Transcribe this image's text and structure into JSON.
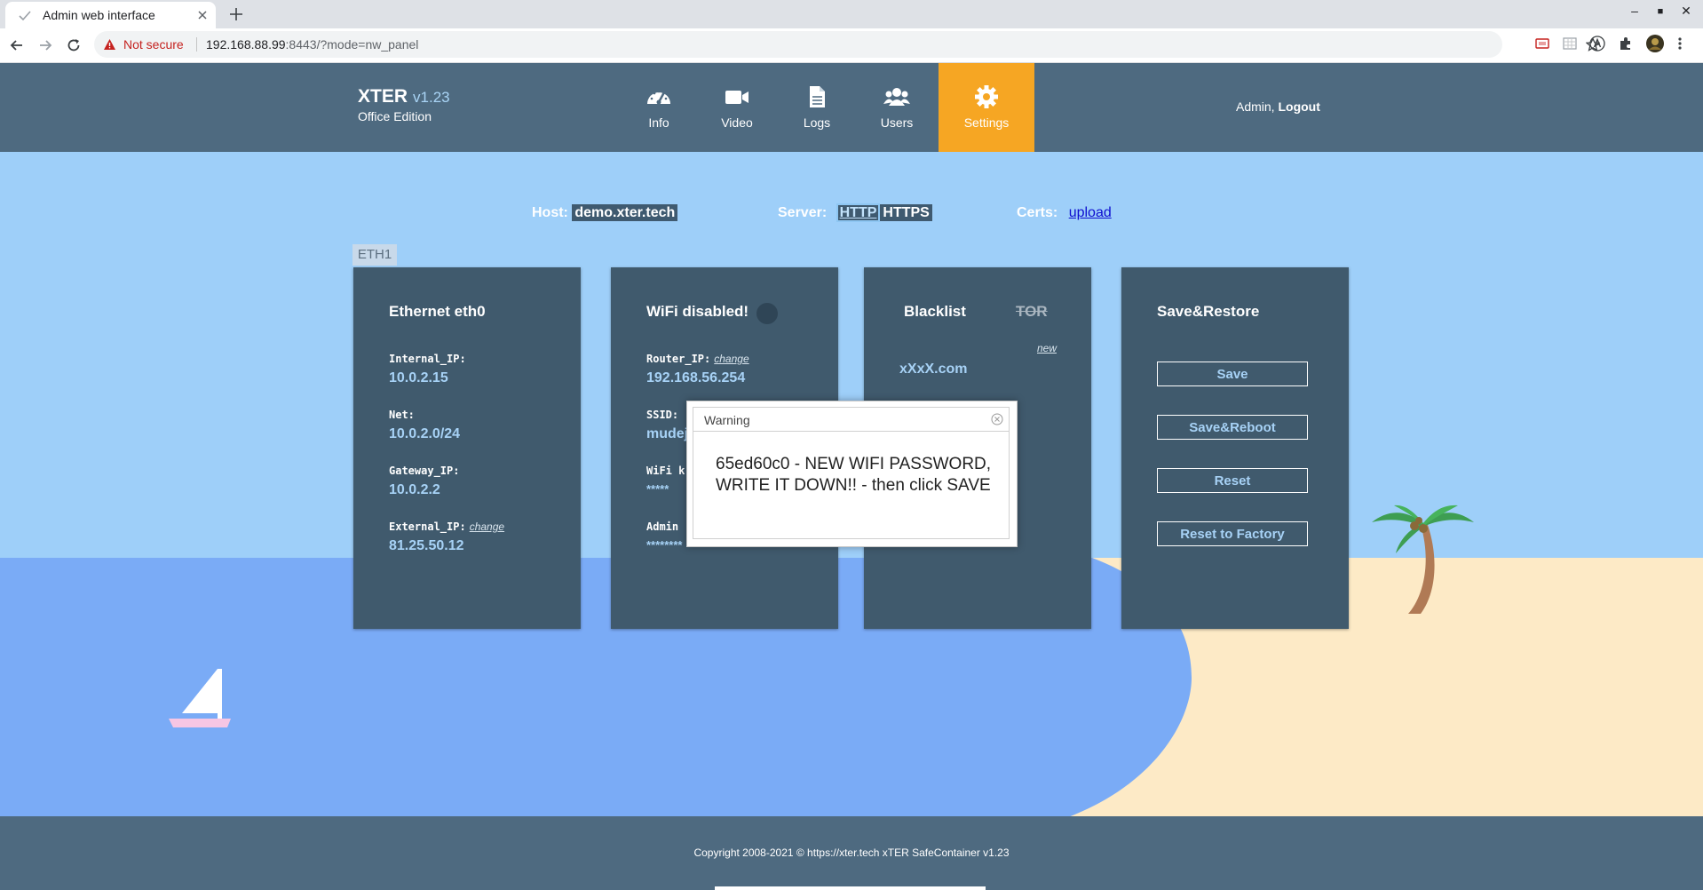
{
  "browser": {
    "tab_title": "Admin web interface",
    "security_label": "Not secure",
    "url_host": "192.168.88.99",
    "url_rest": ":8443/?mode=nw_panel"
  },
  "header": {
    "brand_name": "XTER",
    "brand_version": "v1.23",
    "brand_edition": "Office Edition",
    "nav": [
      {
        "label": "Info",
        "icon": "speedometer-icon"
      },
      {
        "label": "Video",
        "icon": "video-camera-icon"
      },
      {
        "label": "Logs",
        "icon": "document-icon"
      },
      {
        "label": "Users",
        "icon": "users-icon"
      },
      {
        "label": "Settings",
        "icon": "gear-icon",
        "active": true
      }
    ],
    "user_name": "Admin,",
    "logout_label": "Logout"
  },
  "hostbar": {
    "host_label": "Host:",
    "host_value": "demo.xter.tech",
    "server_label": "Server:",
    "server_http": "HTTP",
    "server_https": "HTTPS",
    "certs_label": "Certs:",
    "certs_link": "upload",
    "eth_tab": "ETH1"
  },
  "ethernet": {
    "title": "Ethernet eth0",
    "internal_ip_label": "Internal_IP:",
    "internal_ip": "10.0.2.15",
    "net_label": "Net:",
    "net": "10.0.2.0/24",
    "gateway_label": "Gateway_IP:",
    "gateway": "10.0.2.2",
    "external_label": "External_IP:",
    "external_change": "change",
    "external_ip": "81.25.50.12"
  },
  "wifi": {
    "title": "WiFi disabled!",
    "router_label": "Router_IP:",
    "router_change": "change",
    "router_ip": "192.168.56.254",
    "ssid_label": "SSID:",
    "ssid_value": "mudej",
    "key_label": "WiFi k",
    "key_value": "*****",
    "admin_label": "Admin",
    "admin_value": "********"
  },
  "blacklist": {
    "title": "Blacklist",
    "tor_label": "TOR",
    "new_link": "new",
    "items": [
      "xXxX.com"
    ]
  },
  "save_restore": {
    "title": "Save&Restore",
    "save": "Save",
    "save_reboot": "Save&Reboot",
    "reset": "Reset",
    "reset_factory": "Reset to Factory"
  },
  "modal": {
    "title": "Warning",
    "message": "65ed60c0 - NEW WIFI PASSWORD, WRITE IT DOWN!! - then click SAVE"
  },
  "footer": {
    "copyright": "Copyright 2008-2021 © https://xter.tech xTER SafeContainer v1.23"
  },
  "colors": {
    "header": "#4e6a80",
    "active_nav": "#f6a623",
    "sky": "#9ecff9",
    "sea": "#7aabf6",
    "sand": "#fdeac6",
    "card": "#405a6d",
    "value_text": "#a7d2f6"
  }
}
